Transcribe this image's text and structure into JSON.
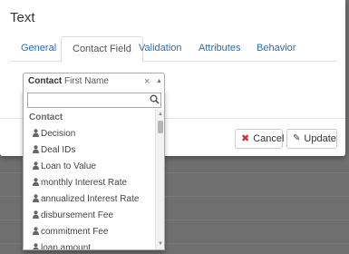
{
  "modal": {
    "title": "Text",
    "tabs": [
      {
        "label": "General"
      },
      {
        "label": "Contact Field"
      },
      {
        "label": "Validation"
      },
      {
        "label": "Attributes"
      },
      {
        "label": "Behavior"
      }
    ],
    "active_tab": "Contact Field"
  },
  "select": {
    "group": "Contact",
    "value": "First Name",
    "clear": "×",
    "caret": "▲"
  },
  "dropdown": {
    "search_value": "",
    "group_label": "Contact",
    "options": [
      {
        "label": "Decision",
        "icon": "user-icon"
      },
      {
        "label": "Deal IDs",
        "icon": "user-icon"
      },
      {
        "label": "Loan to Value",
        "icon": "user-icon"
      },
      {
        "label": "monthly Interest Rate",
        "icon": "user-icon"
      },
      {
        "label": "annualized Interest Rate",
        "icon": "user-icon"
      },
      {
        "label": "disbursement Fee",
        "icon": "user-icon"
      },
      {
        "label": "commitment Fee",
        "icon": "user-icon"
      },
      {
        "label": "loan amount",
        "icon": "user-icon"
      }
    ]
  },
  "footer": {
    "cancel_label": "Cancel",
    "update_label": "Update"
  },
  "colors": {
    "link": "#2a6ebb",
    "backdrop": "#6f6f6f",
    "cancel_icon": "#c9302c"
  }
}
